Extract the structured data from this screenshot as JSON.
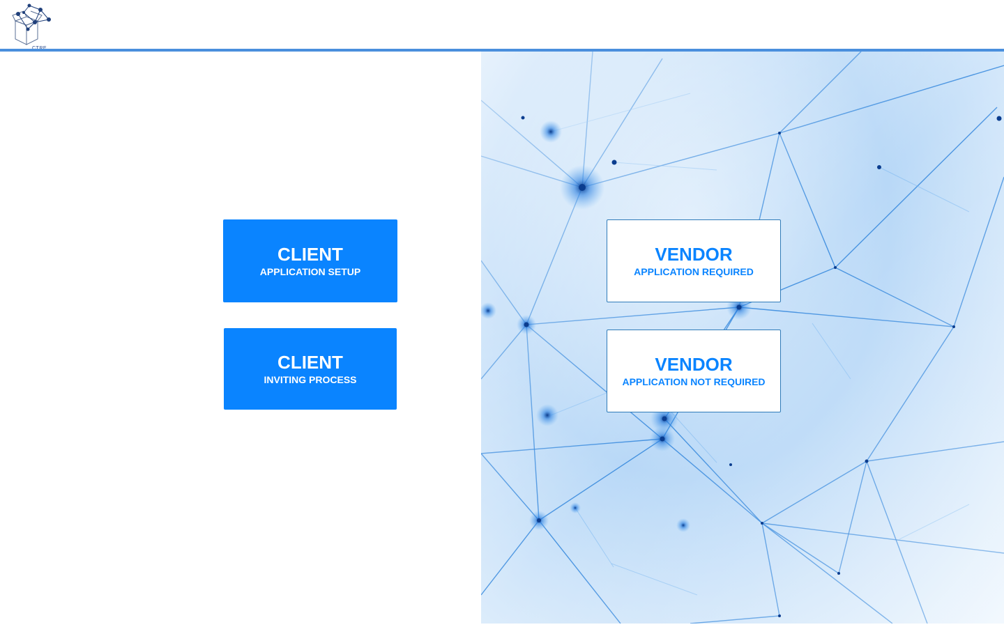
{
  "header": {
    "logo_text": "CTRE"
  },
  "client_buttons": [
    {
      "title": "CLIENT",
      "subtitle": "APPLICATION SETUP"
    },
    {
      "title": "CLIENT",
      "subtitle": "INVITING PROCESS"
    }
  ],
  "vendor_buttons": [
    {
      "title": "VENDOR",
      "subtitle": "APPLICATION REQUIRED"
    },
    {
      "title": "VENDOR",
      "subtitle": "APPLICATION NOT REQUIRED"
    }
  ],
  "colors": {
    "primary_blue": "#0a84ff",
    "header_rule": "#4a8fdd",
    "logo_navy": "#1f3f7a"
  },
  "icons": {
    "logo": "open-box-network-logo-icon",
    "background": "network-graph-background"
  }
}
